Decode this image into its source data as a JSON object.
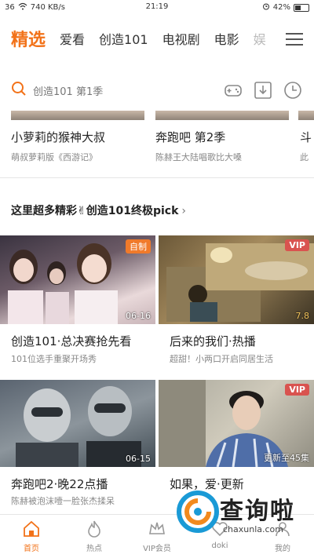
{
  "status": {
    "signal": "36",
    "carrier_icon": "notification-icon",
    "speed": "740 KB/s",
    "time": "21:19",
    "battery": "42%",
    "battery_level": 0.42
  },
  "topnav": {
    "tabs": [
      "精选",
      "爱看",
      "创造101",
      "电视剧",
      "电影",
      "娱"
    ]
  },
  "search": {
    "placeholder": "创造101 第1季"
  },
  "strip": [
    {
      "title": "小萝莉的猴神大叔",
      "subtitle": "萌叔萝莉版《西游记》"
    },
    {
      "title": "奔跑吧 第2季",
      "subtitle": "陈赫王大陆唱歌比大嗓"
    },
    {
      "title": "斗",
      "subtitle": "此"
    }
  ],
  "section": {
    "title": "这里超多精彩✌创造101终极pick",
    "chevron": "›"
  },
  "cards": [
    {
      "title": "创造101·总决赛抢先看",
      "subtitle": "101位选手重聚开场秀",
      "badge": "自制",
      "corner": "06-16"
    },
    {
      "title": "后来的我们·热播",
      "subtitle": "超甜！小两口开启同居生活",
      "badge": "VIP",
      "corner": "7.8"
    },
    {
      "title": "奔跑吧2·晚22点播",
      "subtitle": "陈赫被泡沫噎一脸张杰揉呆",
      "badge": "",
      "corner": "06-15"
    },
    {
      "title": "如果，爱·更新",
      "subtitle": "",
      "badge": "VIP",
      "corner": "更新至45集"
    }
  ],
  "tabbar": [
    {
      "label": "首页"
    },
    {
      "label": "热点"
    },
    {
      "label": "VIP会员"
    },
    {
      "label": "doki"
    },
    {
      "label": "我的"
    }
  ],
  "watermark": {
    "brand": "查询啦",
    "domain": "chaxunla.com"
  },
  "colors": {
    "accent": "#f27219",
    "vip": "#d9534f"
  }
}
